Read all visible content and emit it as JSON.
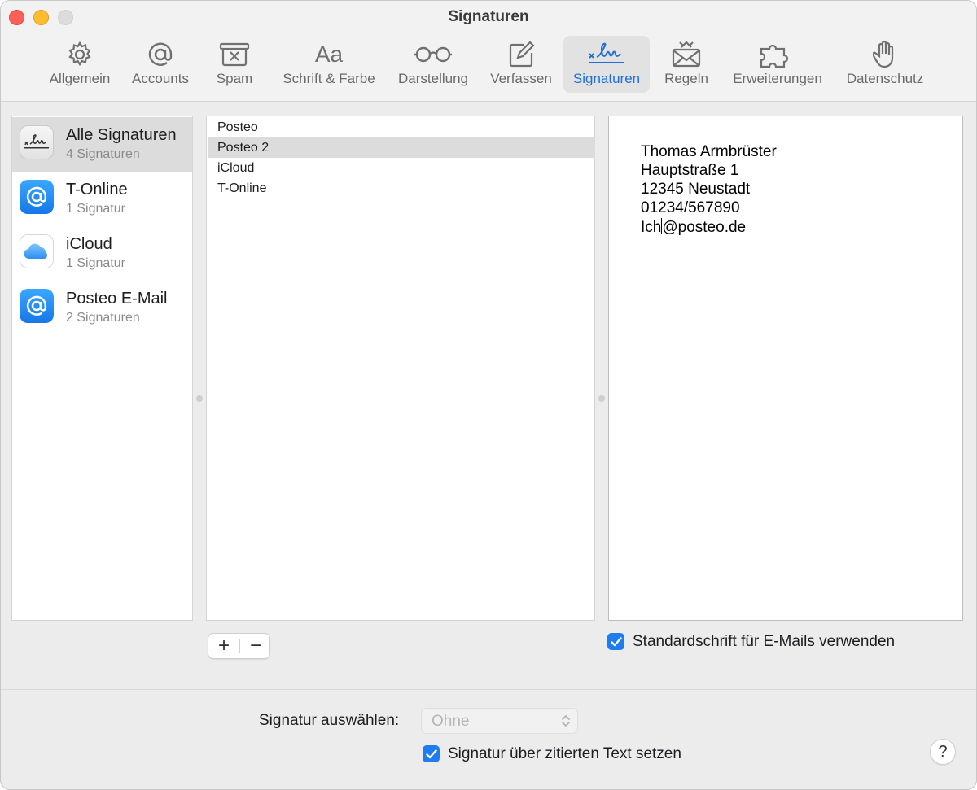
{
  "window": {
    "title": "Signaturen"
  },
  "toolbar": {
    "items": [
      {
        "label": "Allgemein",
        "icon": "gear-icon"
      },
      {
        "label": "Accounts",
        "icon": "at-icon"
      },
      {
        "label": "Spam",
        "icon": "junk-tray-icon"
      },
      {
        "label": "Schrift & Farbe",
        "icon": "Aa",
        "glyph": "Aa"
      },
      {
        "label": "Darstellung",
        "icon": "glasses-icon"
      },
      {
        "label": "Verfassen",
        "icon": "compose-icon"
      },
      {
        "label": "Signaturen",
        "icon": "signature-icon",
        "active": true
      },
      {
        "label": "Regeln",
        "icon": "rules-envelope-icon"
      },
      {
        "label": "Erweiterungen",
        "icon": "puzzle-icon"
      },
      {
        "label": "Datenschutz",
        "icon": "hand-icon"
      }
    ]
  },
  "accounts": [
    {
      "name": "Alle Signaturen",
      "count": "4 Signaturen",
      "icon": "signature-icon",
      "selected": true
    },
    {
      "name": "T-Online",
      "count": "1 Signatur",
      "icon": "at-icon"
    },
    {
      "name": "iCloud",
      "count": "1 Signatur",
      "icon": "icloud-icon"
    },
    {
      "name": "Posteo E-Mail",
      "count": "2 Signaturen",
      "icon": "at-icon"
    }
  ],
  "signatures": [
    {
      "name": "Posteo"
    },
    {
      "name": "Posteo 2",
      "selected": true
    },
    {
      "name": "iCloud"
    },
    {
      "name": "T-Online"
    }
  ],
  "editor": {
    "lines": [
      "Thomas Armbrüster",
      "Hauptstraße 1",
      "12345 Neustadt",
      "01234/567890"
    ],
    "email_before_caret": "Ich",
    "email_after_caret": "@posteo.de"
  },
  "controls": {
    "add_label": "+",
    "remove_label": "−",
    "default_font_label": "Standardschrift für E-Mails verwenden",
    "default_font_checked": true,
    "choose_signature_label": "Signatur auswählen:",
    "choose_signature_value": "Ohne",
    "above_quoted_label": "Signatur über zitierten Text setzen",
    "above_quoted_checked": true,
    "help_label": "?"
  },
  "colors": {
    "accent": "#1f7cf0",
    "active_label": "#1f6fd6",
    "close": "#fe5f57",
    "minimize": "#febc2e"
  }
}
